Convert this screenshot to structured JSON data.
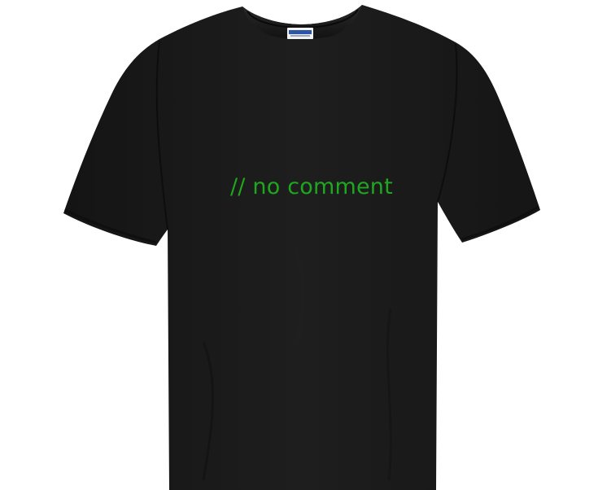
{
  "product": {
    "shirt_color": "#1a1a1a",
    "print_text": "// no comment",
    "print_color": "#1fa71f",
    "tag_color": "#2e56a6"
  }
}
